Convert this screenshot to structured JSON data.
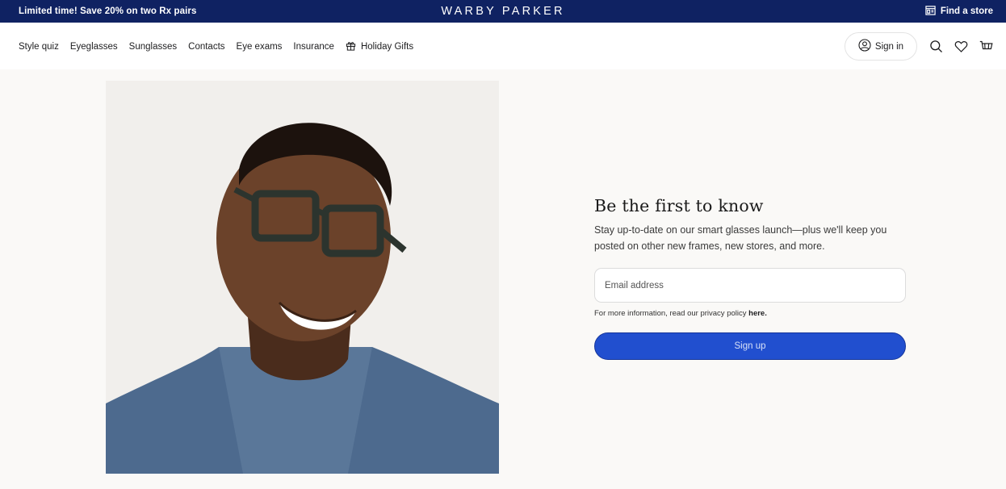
{
  "promo": {
    "text": "Limited time! Save 20% on two Rx pairs",
    "brand": "WARBY PARKER",
    "find_store": "Find a store"
  },
  "nav": {
    "items": [
      "Style quiz",
      "Eyeglasses",
      "Sunglasses",
      "Contacts",
      "Eye exams",
      "Insurance"
    ],
    "holiday": "Holiday Gifts",
    "sign_in": "Sign in"
  },
  "signup": {
    "title": "Be the first to know",
    "description": "Stay up-to-date on our smart glasses launch—plus we'll keep you posted on other new frames, new stores, and more.",
    "email_placeholder": "Email address",
    "privacy_prefix": "For more information, read our privacy policy ",
    "privacy_link": "here.",
    "button": "Sign up"
  },
  "colors": {
    "promo_bg": "#0f2262",
    "accent_button": "#214fcf",
    "page_bg": "#faf9f7"
  }
}
